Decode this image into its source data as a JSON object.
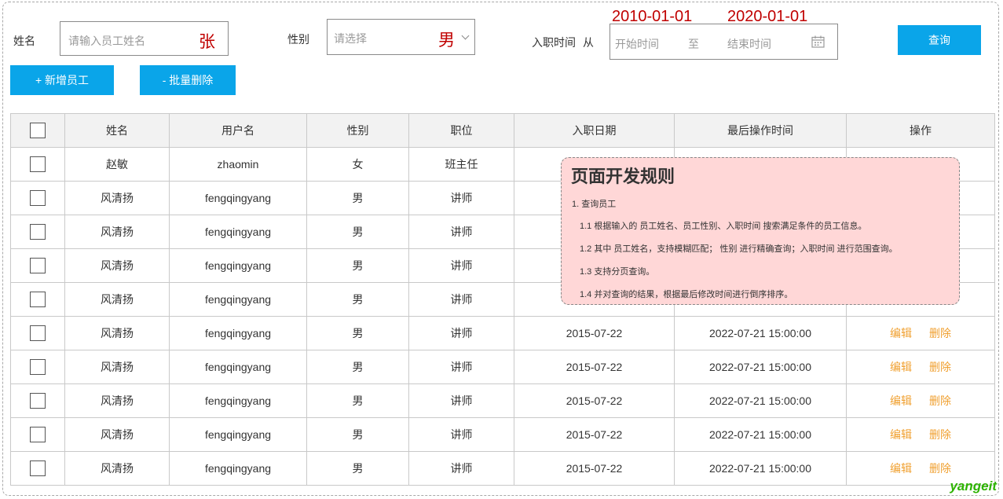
{
  "filters": {
    "name_label": "姓名",
    "name_placeholder": "请输入员工姓名",
    "name_annotation": "张",
    "gender_label": "性别",
    "gender_placeholder": "请选择",
    "gender_annotation": "男",
    "date_label": "入职时间",
    "date_from_label": "从",
    "date_start_placeholder": "开始时间",
    "date_separator": "至",
    "date_end_placeholder": "结束时间",
    "date_start_annotation": "2010-01-01",
    "date_end_annotation": "2020-01-01",
    "query_button": "查询"
  },
  "actions": {
    "add_button": "+ 新增员工",
    "batch_delete_button": "- 批量删除"
  },
  "table": {
    "headers": [
      "姓名",
      "用户名",
      "性别",
      "职位",
      "入职日期",
      "最后操作时间",
      "操作"
    ],
    "edit_label": "编辑",
    "delete_label": "删除",
    "rows": [
      {
        "name": "赵敏",
        "username": "zhaomin",
        "gender": "女",
        "position": "班主任",
        "hire_date": "",
        "last_op": ""
      },
      {
        "name": "风清扬",
        "username": "fengqingyang",
        "gender": "男",
        "position": "讲师",
        "hire_date": "",
        "last_op": ""
      },
      {
        "name": "风清扬",
        "username": "fengqingyang",
        "gender": "男",
        "position": "讲师",
        "hire_date": "",
        "last_op": ""
      },
      {
        "name": "风清扬",
        "username": "fengqingyang",
        "gender": "男",
        "position": "讲师",
        "hire_date": "",
        "last_op": ""
      },
      {
        "name": "风清扬",
        "username": "fengqingyang",
        "gender": "男",
        "position": "讲师",
        "hire_date": "",
        "last_op": ""
      },
      {
        "name": "风清扬",
        "username": "fengqingyang",
        "gender": "男",
        "position": "讲师",
        "hire_date": "2015-07-22",
        "last_op": "2022-07-21 15:00:00"
      },
      {
        "name": "风清扬",
        "username": "fengqingyang",
        "gender": "男",
        "position": "讲师",
        "hire_date": "2015-07-22",
        "last_op": "2022-07-21 15:00:00"
      },
      {
        "name": "风清扬",
        "username": "fengqingyang",
        "gender": "男",
        "position": "讲师",
        "hire_date": "2015-07-22",
        "last_op": "2022-07-21 15:00:00"
      },
      {
        "name": "风清扬",
        "username": "fengqingyang",
        "gender": "男",
        "position": "讲师",
        "hire_date": "2015-07-22",
        "last_op": "2022-07-21 15:00:00"
      },
      {
        "name": "风清扬",
        "username": "fengqingyang",
        "gender": "男",
        "position": "讲师",
        "hire_date": "2015-07-22",
        "last_op": "2022-07-21 15:00:00"
      }
    ]
  },
  "note": {
    "title": "页面开发规则",
    "lines": [
      "1. 查询员工",
      "1.1 根据输入的 员工姓名、员工性别、入职时间 搜索满足条件的员工信息。",
      "1.2 其中 员工姓名，支持模糊匹配； 性别 进行精确查询；入职时间 进行范围查询。",
      "1.3 支持分页查询。",
      "1.4 并对查询的结果，根据最后修改时间进行倒序排序。"
    ]
  },
  "watermark": "yangeit",
  "colors": {
    "button_blue": "#0aa5e9",
    "annotation_red": "#c00000",
    "op_orange": "#f0a030",
    "note_bg": "#ffd7d7",
    "watermark_green": "#2db300"
  },
  "icons": {
    "calendar": "calendar-icon",
    "dropdown": "chevron-down-icon"
  }
}
